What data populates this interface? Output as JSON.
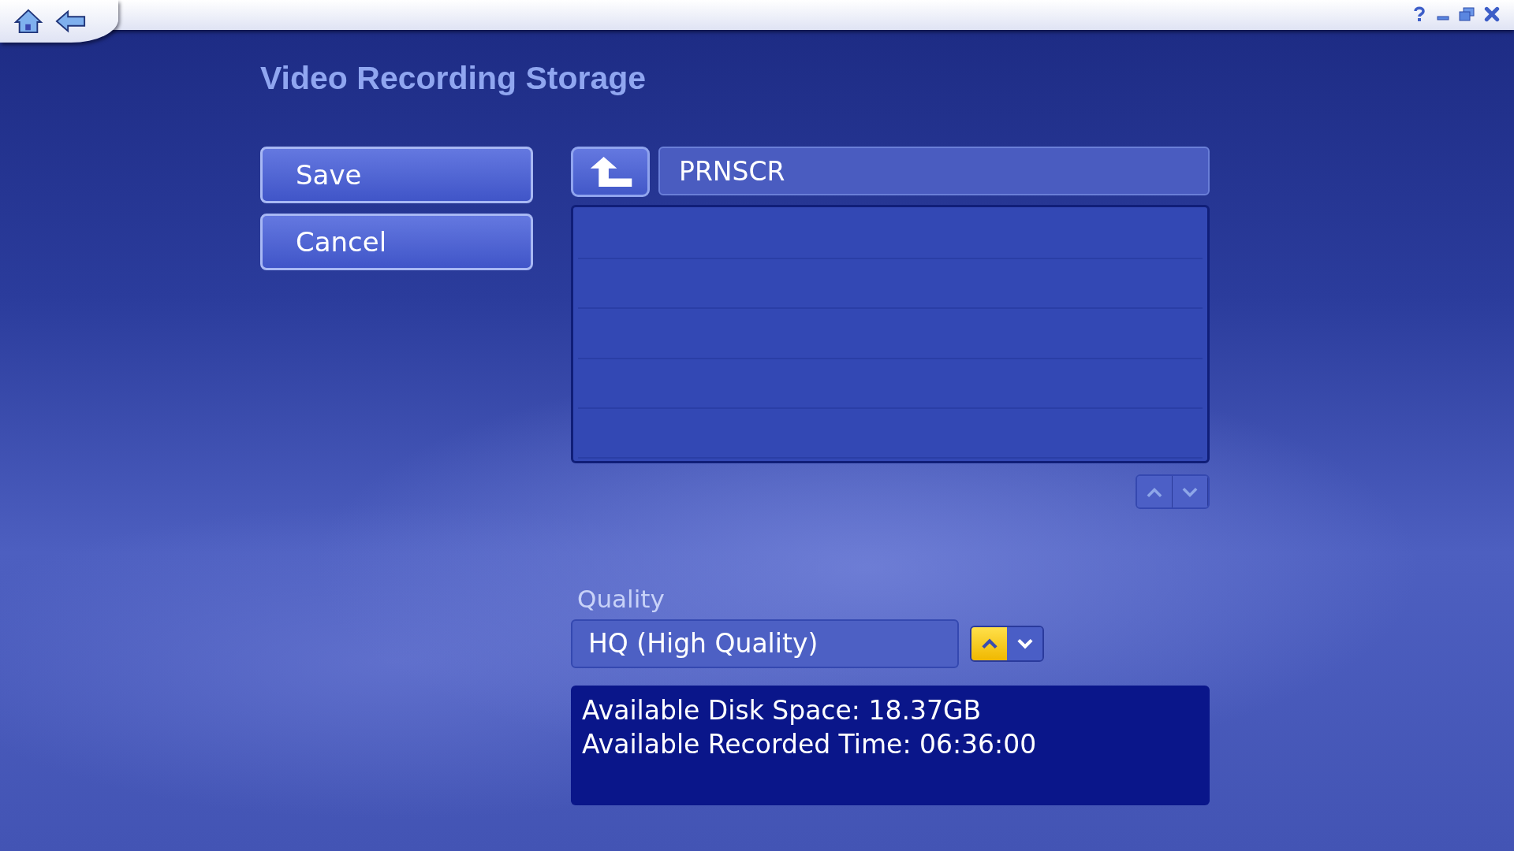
{
  "page": {
    "title": "Video Recording Storage"
  },
  "buttons": [
    {
      "label": "Save"
    },
    {
      "label": "Cancel"
    }
  ],
  "folder": {
    "value": "PRNSCR"
  },
  "quality": {
    "label": "Quality",
    "value": "HQ (High Quality)",
    "arrows": [
      {
        "kind": "up",
        "highlighted": true
      },
      {
        "kind": "down",
        "highlighted": false
      }
    ]
  },
  "info": {
    "lines": [
      "Available Disk Space: 18.37GB",
      "Available Recorded Time: 06:36:00"
    ]
  }
}
